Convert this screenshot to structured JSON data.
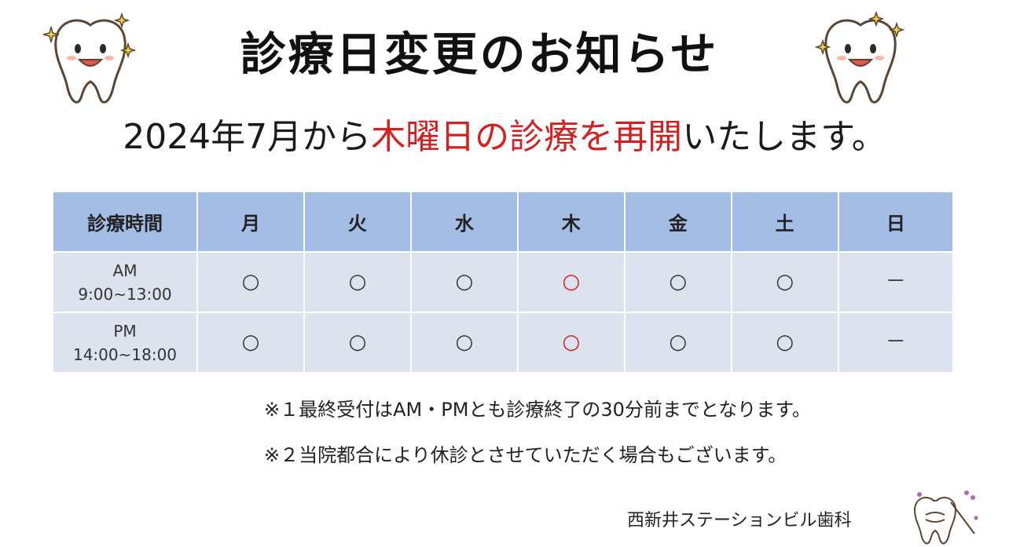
{
  "title": "診療日変更のお知らせ",
  "subtitle": {
    "part1": "2024年7月から",
    "highlight": "木曜日の診療を再開",
    "part2": "いたします。"
  },
  "table": {
    "headers": [
      "診療時間",
      "月",
      "火",
      "水",
      "木",
      "金",
      "土",
      "日"
    ],
    "rows": [
      {
        "label_line1": "AM",
        "label_line2": "9:00~13:00",
        "cells": [
          "○",
          "○",
          "○",
          "○",
          "○",
          "○",
          "－"
        ]
      },
      {
        "label_line1": "PM",
        "label_line2": "14:00~18:00",
        "cells": [
          "○",
          "○",
          "○",
          "○",
          "○",
          "○",
          "－"
        ]
      }
    ]
  },
  "notes": [
    "※１最終受付はAM・PMとも診療終了の30分前までとなります。",
    "※２当院都合により休診とさせていただく場合もございます。"
  ],
  "clinic_name": "西新井ステーションビル歯科",
  "colors": {
    "accent_red": "#d42020",
    "header_bg": "#a4bde4",
    "cell_bg": "#dce3ee"
  }
}
